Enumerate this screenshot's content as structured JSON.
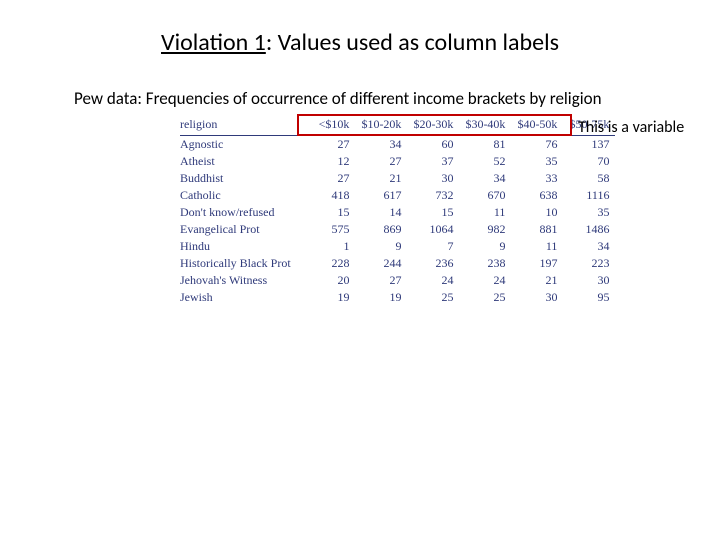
{
  "title": {
    "part1": "Violation 1",
    "part2": ": Values used as column labels"
  },
  "subtitle": "Pew data: Frequencies of occurrence of different income brackets by religion",
  "annotation": "This is a variable",
  "table": {
    "headers": [
      "religion",
      "<$10k",
      "$10-20k",
      "$20-30k",
      "$30-40k",
      "$40-50k",
      "$50-75k"
    ],
    "rows": [
      [
        "Agnostic",
        27,
        34,
        60,
        81,
        76,
        137
      ],
      [
        "Atheist",
        12,
        27,
        37,
        52,
        35,
        70
      ],
      [
        "Buddhist",
        27,
        21,
        30,
        34,
        33,
        58
      ],
      [
        "Catholic",
        418,
        617,
        732,
        670,
        638,
        1116
      ],
      [
        "Don't know/refused",
        15,
        14,
        15,
        11,
        10,
        35
      ],
      [
        "Evangelical Prot",
        575,
        869,
        1064,
        982,
        881,
        1486
      ],
      [
        "Hindu",
        1,
        9,
        7,
        9,
        11,
        34
      ],
      [
        "Historically Black Prot",
        228,
        244,
        236,
        238,
        197,
        223
      ],
      [
        "Jehovah's Witness",
        20,
        27,
        24,
        24,
        21,
        30
      ],
      [
        "Jewish",
        19,
        19,
        25,
        25,
        30,
        95
      ]
    ]
  }
}
